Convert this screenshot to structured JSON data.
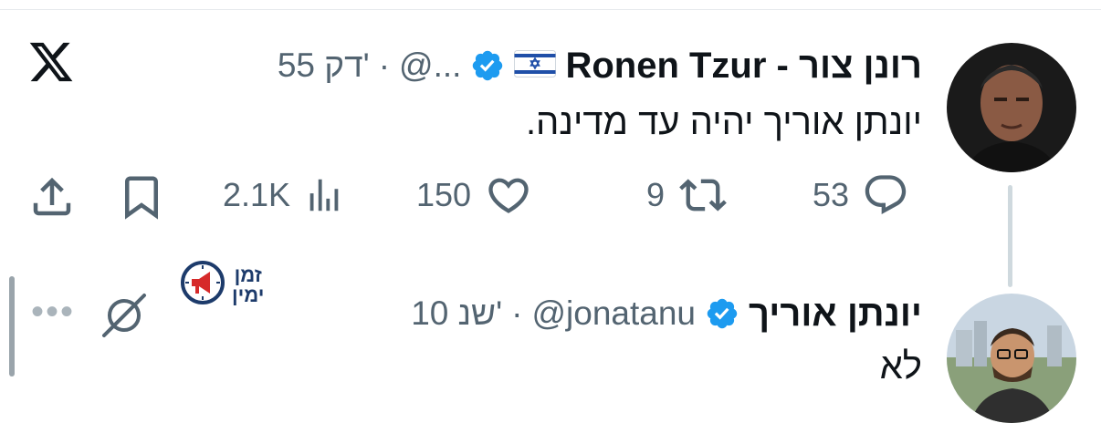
{
  "tweet": {
    "author_name": "רונן צור - Ronen Tzur",
    "flag_icon": "israel-flag-icon",
    "verified_icon": "verified-badge-icon",
    "handle": "@...",
    "separator": "·",
    "time": "55 דק'",
    "text": "יונתן אוריך יהיה עד מדינה."
  },
  "actions": {
    "replies": "53",
    "retweets": "9",
    "likes": "150",
    "views": "2.1K",
    "icons": [
      "reply-icon",
      "retweet-icon",
      "like-icon",
      "views-icon",
      "bookmark-icon",
      "share-icon"
    ]
  },
  "reply": {
    "author_name": "יונתן אוריך",
    "verified_icon": "verified-badge-icon",
    "handle": "@jonatanu",
    "separator": "·",
    "time": "10 שנ'",
    "text": "לא",
    "more_label": "•••"
  },
  "badge": {
    "line1": "זמן",
    "line2": "ימין",
    "icon": "megaphone-clock-icon"
  },
  "colors": {
    "text_primary": "#0f1419",
    "text_secondary": "#536471",
    "verified_blue": "#1d9bf0",
    "thread_line": "#cfd9de",
    "badge_blue": "#1d3b6b",
    "badge_red": "#d62a2a"
  }
}
